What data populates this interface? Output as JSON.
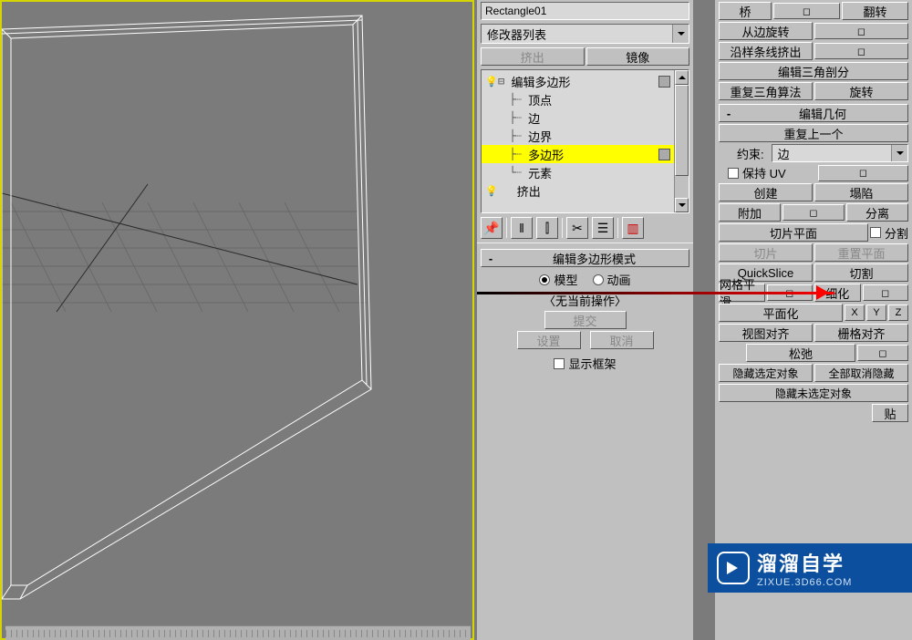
{
  "object_name": "Rectangle01",
  "modifier_combo": "修改器列表",
  "mid_buttons": {
    "extrude": "挤出",
    "mirror": "镜像"
  },
  "tree": {
    "root": "编辑多边形",
    "items": [
      "顶点",
      "边",
      "边界",
      "多边形",
      "元素"
    ],
    "sub": "挤出"
  },
  "mode_rollout": {
    "title": "编辑多边形模式",
    "radio_model": "模型",
    "radio_anim": "动画",
    "no_op": "〈无当前操作〉",
    "commit": "提交",
    "settings": "设置",
    "cancel": "取消",
    "show_frame": "显示框架"
  },
  "right": {
    "bridge": "桥",
    "flip": "翻转",
    "spin_edge": "从边旋转",
    "extrude_spline": "沿样条线挤出",
    "edit_tri": "编辑三角剖分",
    "retriangulate": "重复三角算法",
    "rotate": "旋转",
    "edit_geom_hdr": "编辑几何",
    "repeat_last": "重复上一个",
    "constraint_label": "约束:",
    "constraint_value": "边",
    "preserve_uv": "保持 UV",
    "create": "创建",
    "collapse": "塌陷",
    "attach": "附加",
    "detach": "分离",
    "slice_plane": "切片平面",
    "split": "分割",
    "slice": "切片",
    "reset_plane": "重置平面",
    "quickslice": "QuickSlice",
    "cut": "切割",
    "msmooth": "网格平滑",
    "tessellate": "细化",
    "planarize": "平面化",
    "x": "X",
    "y": "Y",
    "z": "Z",
    "view_align": "视图对齐",
    "grid_align": "栅格对齐",
    "relax": "松弛",
    "hide_sel": "隐藏选定对象",
    "unhide_all": "全部取消隐藏",
    "hide_unsel": "隐藏未选定对象",
    "paste": "贴"
  },
  "watermark": {
    "main": "溜溜自学",
    "sub": "ZIXUE.3D66.COM"
  }
}
